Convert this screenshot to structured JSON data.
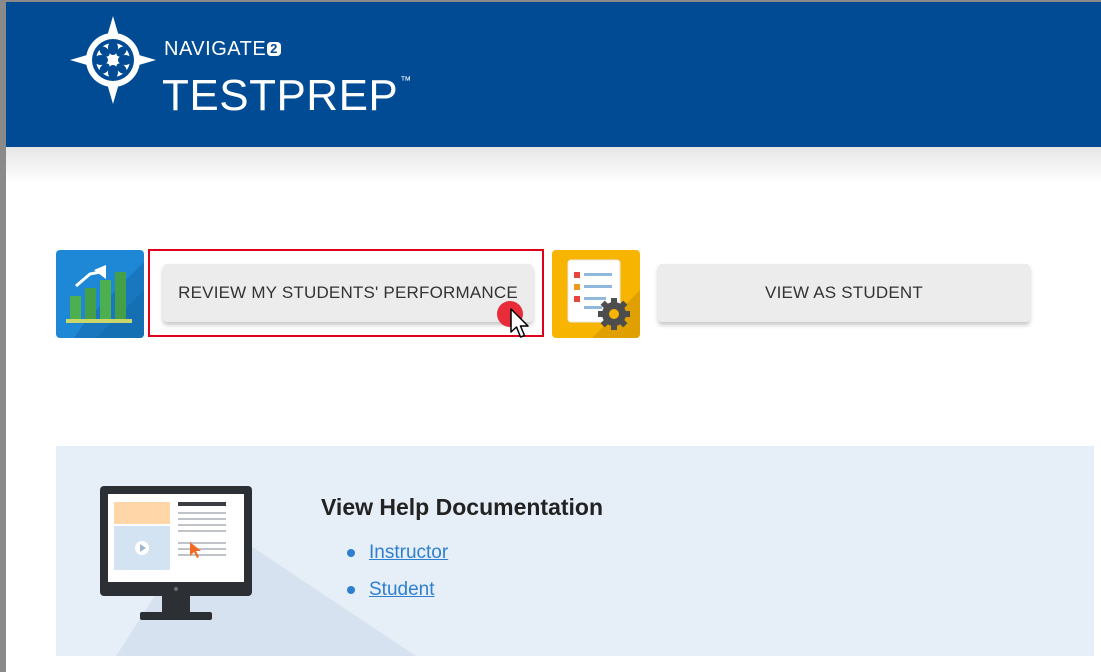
{
  "header": {
    "brand_top": "NAVIGATE",
    "brand_sup": "2",
    "brand_main": "TESTPREP",
    "brand_tm": "™",
    "background_color": "#004b93"
  },
  "actions": {
    "review_button_label": "REVIEW MY STUDENTS' PERFORMANCE",
    "view_as_student_label": "VIEW AS STUDENT",
    "review_icon": "bar-chart-growth-icon",
    "student_icon": "document-settings-icon",
    "highlight_color": "#e0001b"
  },
  "help": {
    "title": "View Help Documentation",
    "links": [
      {
        "label": "Instructor"
      },
      {
        "label": "Student"
      }
    ],
    "icon": "computer-monitor-icon",
    "link_color": "#2f7fd0"
  }
}
